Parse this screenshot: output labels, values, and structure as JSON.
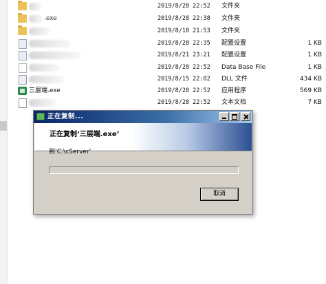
{
  "file_list": [
    {
      "icon": "folder-icon",
      "name": "",
      "name_blurred": true,
      "date": "2019/8/28 22:52",
      "type": "文件夹",
      "size": ""
    },
    {
      "icon": "folder-icon",
      "name": ".exe",
      "name_blurred": true,
      "date": "2019/8/28 22:38",
      "type": "文件夹",
      "size": ""
    },
    {
      "icon": "folder-icon",
      "name": "",
      "name_blurred": true,
      "date": "2019/8/18 21:53",
      "type": "文件夹",
      "size": ""
    },
    {
      "icon": "config-file-icon",
      "name": "",
      "name_blurred": true,
      "date": "2019/8/28 22:35",
      "type": "配置设置",
      "size": "1 KB"
    },
    {
      "icon": "config-file-icon",
      "name": "",
      "name_blurred": true,
      "date": "2019/8/21 23:21",
      "type": "配置设置",
      "size": "1 KB"
    },
    {
      "icon": "file-icon",
      "name": "",
      "name_blurred": true,
      "date": "2019/8/28 22:52",
      "type": "Data Base File",
      "size": "1 KB"
    },
    {
      "icon": "dll-file-icon",
      "name": "",
      "name_blurred": true,
      "date": "2019/8/15 22:02",
      "type": "DLL 文件",
      "size": "434 KB"
    },
    {
      "icon": "exe-app-icon",
      "name": "三层端.exe",
      "name_blurred": false,
      "date": "2019/8/28 22:52",
      "type": "应用程序",
      "size": "569 KB"
    },
    {
      "icon": "text-file-icon",
      "name": "",
      "name_blurred": true,
      "date": "2019/8/28 22:52",
      "type": "文本文档",
      "size": "7 KB"
    }
  ],
  "dialog": {
    "title": "正在复制...",
    "heading": "正在复制‘三层端.exe’",
    "destination": "到‘C:\\cServer’",
    "progress": 0,
    "cancel_label": "取消"
  },
  "colors": {
    "titlebar_start": "#0a246a",
    "titlebar_end": "#a6caf0",
    "dialog_face": "#d4d0c8",
    "banner_accent": "#2b4f93"
  }
}
